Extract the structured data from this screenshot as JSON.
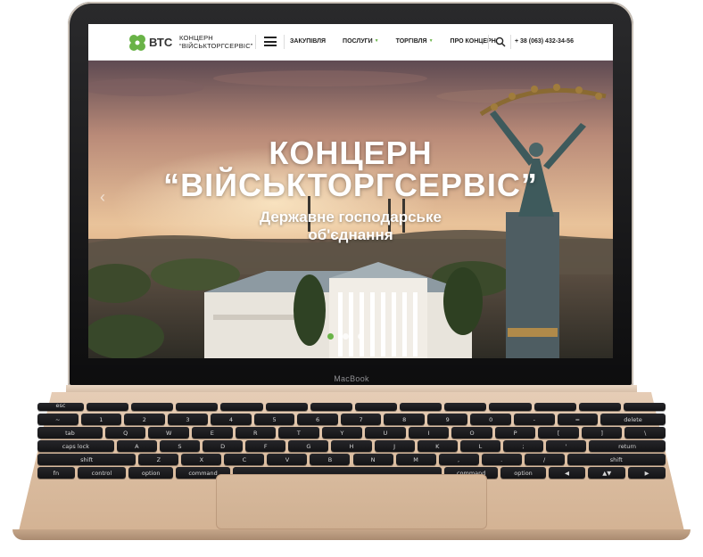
{
  "device": {
    "model_label": "MacBook"
  },
  "header": {
    "logo_icon": "clover-logo-icon",
    "logo_text": "ВТС",
    "brand_line1": "КОНЦЕРН",
    "brand_line2": "“ВІЙСЬКТОРГСЕРВІС”",
    "menu_icon": "hamburger-menu-icon",
    "nav": [
      {
        "label": "ЗАКУПІВЛЯ",
        "has_dropdown": false
      },
      {
        "label": "ПОСЛУГИ",
        "has_dropdown": true
      },
      {
        "label": "ТОРГІВЛЯ",
        "has_dropdown": true
      },
      {
        "label": "ПРО КОНЦЕРН",
        "has_dropdown": false
      }
    ],
    "search_icon": "search-icon",
    "phone": "+ 38 (063) 432-34-56"
  },
  "hero": {
    "title_line1": "КОНЦЕРН",
    "title_line2": "“ВІЙСЬКТОРГСЕРВІС”",
    "subtitle_line1": "Державне господарське",
    "subtitle_line2": "об'єднання",
    "prev_arrow_icon": "chevron-left-icon",
    "slides_total": 3,
    "active_slide": 1
  },
  "colors": {
    "accent_green": "#69b347",
    "header_bg": "#ffffff",
    "device_gold": "#dcbfa3"
  },
  "keyboard": {
    "rows": [
      [
        "esc",
        "",
        "",
        "",
        "",
        "",
        "",
        "",
        "",
        "",
        "",
        "",
        "",
        ""
      ],
      [
        "~",
        "1",
        "2",
        "3",
        "4",
        "5",
        "6",
        "7",
        "8",
        "9",
        "0",
        "-",
        "=",
        "delete"
      ],
      [
        "tab",
        "Q",
        "W",
        "E",
        "R",
        "T",
        "Y",
        "U",
        "I",
        "O",
        "P",
        "[",
        "]",
        "\\"
      ],
      [
        "caps lock",
        "A",
        "S",
        "D",
        "F",
        "G",
        "H",
        "J",
        "K",
        "L",
        ";",
        "'",
        "return"
      ],
      [
        "shift",
        "Z",
        "X",
        "C",
        "V",
        "B",
        "N",
        "M",
        ",",
        ".",
        "/",
        "shift"
      ],
      [
        "fn",
        "control",
        "option",
        "command",
        "",
        "command",
        "option",
        "◀",
        "▲▼",
        "▶"
      ]
    ]
  }
}
